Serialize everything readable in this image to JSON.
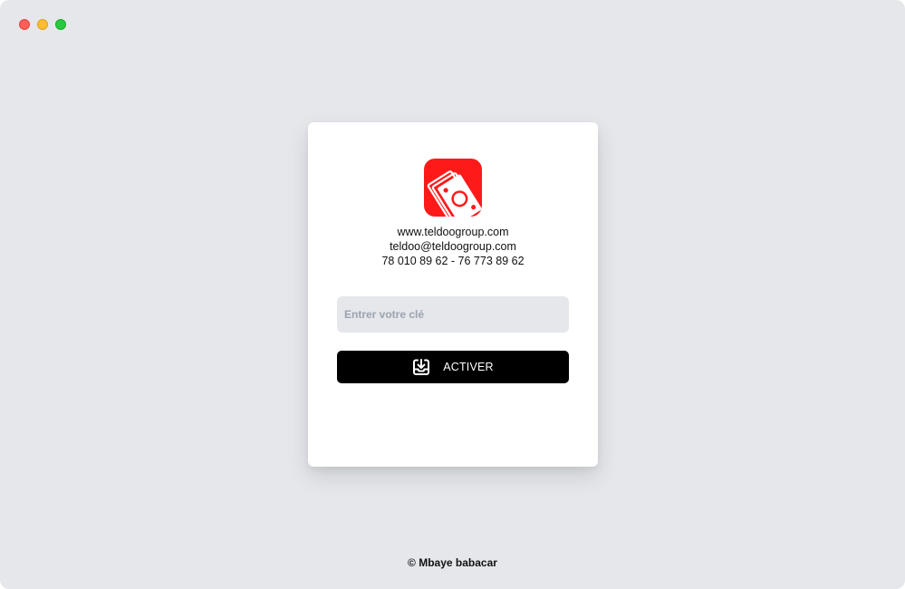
{
  "window": {
    "controls": [
      "close",
      "minimize",
      "maximize"
    ],
    "background": "#e5e7eb"
  },
  "logo": {
    "icon": "money-bills-icon",
    "color": "#ff1a1a"
  },
  "contact": {
    "website": "www.teldoogroup.com",
    "email": "teldoo@teldoogroup.com",
    "phones": "78 010 89 62 - 76 773 89 62"
  },
  "key_field": {
    "placeholder": "Entrer votre clé",
    "value": ""
  },
  "activate_button": {
    "icon": "download-tray-icon",
    "label": "ACTIVER"
  },
  "footer": {
    "copyright": "© Mbaye babacar"
  }
}
